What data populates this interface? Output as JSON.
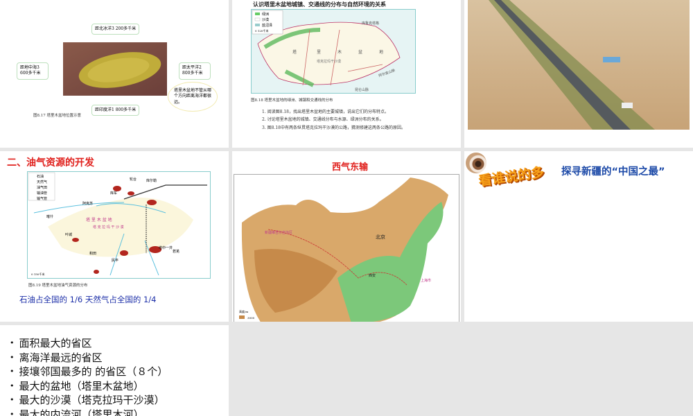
{
  "slide1": {
    "north": "距北冰洋3 200多千米",
    "west": "距地中海3 600多千米",
    "east": "距太平洋2 800多千米",
    "south": "距印度洋1 800多千米",
    "note": "塔里木盆地不管从哪个方向距离海洋都很远。",
    "caption": "图8.17 塔里木盆地位置示意"
  },
  "slide2": {
    "heading": "认识塔里木盆地城镇、交通线的分布与自然环境的关系",
    "legend": [
      "绿洲",
      "沙漠",
      "盐沼泽"
    ],
    "scale": "0  120千米",
    "map_labels": [
      "塔",
      "里",
      "木",
      "盆",
      "地",
      "塔克拉玛干沙漠",
      "阿尔金山脉",
      "昆仑山脉",
      "库鲁克塔格"
    ],
    "caption": "图8.18 塔里木盆地的绿洲、城镇和交通线的分布",
    "questions": [
      "1. 阅读图8.18，找出塔里木盆地的主要城镇，说出它们的分布特点。",
      "2. 讨论塔里木盆地的城镇、交通线分布与水源、绿洲分布的关系。",
      "3. 图8.18中有两条纵贯塔克拉玛干沙漠的公路，猜测修建这两条公路的原因。"
    ]
  },
  "slide4": {
    "title": "二、油气资源的开发",
    "legend": [
      "石油",
      "天然气",
      "油气田",
      "输油管",
      "输气管"
    ],
    "cities": [
      "库尔勒",
      "轮台",
      "库车",
      "阿克苏",
      "喀什",
      "塔中一井",
      "若羌",
      "叶城",
      "和田",
      "民丰",
      "且末"
    ],
    "map_labels": "塔 里 木 盆 地",
    "desert": "塔 克 拉 玛 干 沙 漠",
    "scale": "0   150千米",
    "caption": "图8.19 塔里木盆地油气资源的分布",
    "stat": "石油占全国的 1/6  天然气占全国的 1/4"
  },
  "slide5": {
    "title": "西气东输",
    "labels": [
      "北京",
      "上海市",
      "西安",
      "新疆维吾尔自治区"
    ],
    "legend_title": "高度/m",
    "legend_value": "3000"
  },
  "slide6": {
    "badge": "看谁说的多",
    "title": "探寻新疆的“中国之最”"
  },
  "slide7": {
    "bullets": [
      "面积最大的省区",
      "离海洋最远的省区",
      "接壤邻国最多的 的省区（８个）",
      "最大的盆地（塔里木盆地）",
      "最大的沙漠（塔克拉玛干沙漠）",
      "最大的内流河（塔里木河）"
    ]
  }
}
